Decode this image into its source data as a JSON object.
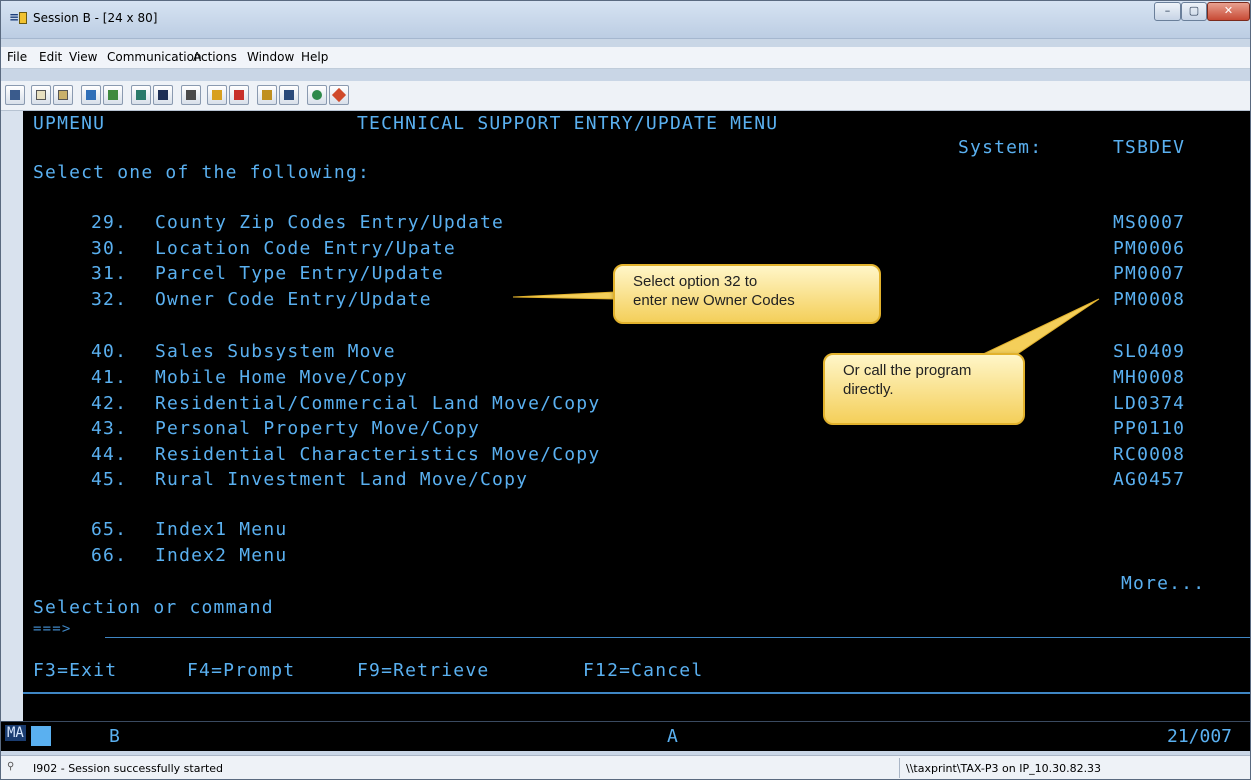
{
  "window": {
    "title": "Session B - [24 x 80]",
    "controls": {
      "minimize": "–",
      "maximize": "▢",
      "close": "✕"
    }
  },
  "menubar": {
    "items": [
      "File",
      "Edit",
      "View",
      "Communication",
      "Actions",
      "Window",
      "Help"
    ]
  },
  "toolbar": {
    "icons": [
      "display-icon",
      "copy-icon",
      "paste-icon",
      "send-icon",
      "receive-icon",
      "screen-icon",
      "macro-icon",
      "keyboard-icon",
      "record-icon",
      "stop-icon",
      "play-icon",
      "pause-icon",
      "globe-icon",
      "pencil-icon"
    ]
  },
  "screen": {
    "menu_id": "UPMENU",
    "title": "TECHNICAL SUPPORT ENTRY/UPDATE MENU",
    "system_label": "System:",
    "system_value": "TSBDEV",
    "instruction": "Select one of the following:",
    "options": [
      {
        "number": "29.",
        "label": "County Zip Codes Entry/Update",
        "program": "MS0007"
      },
      {
        "number": "30.",
        "label": "Location Code Entry/Upate",
        "program": "PM0006"
      },
      {
        "number": "31.",
        "label": "Parcel Type Entry/Update",
        "program": "PM0007"
      },
      {
        "number": "32.",
        "label": "Owner Code Entry/Update",
        "program": "PM0008"
      },
      {
        "number": "40.",
        "label": "Sales Subsystem Move",
        "program": "SL0409"
      },
      {
        "number": "41.",
        "label": "Mobile Home Move/Copy",
        "program": "MH0008"
      },
      {
        "number": "42.",
        "label": "Residential/Commercial Land Move/Copy",
        "program": "LD0374"
      },
      {
        "number": "43.",
        "label": "Personal Property Move/Copy",
        "program": "PP0110"
      },
      {
        "number": "44.",
        "label": "Residential Characteristics Move/Copy",
        "program": "RC0008"
      },
      {
        "number": "45.",
        "label": "Rural Investment Land Move/Copy",
        "program": "AG0457"
      },
      {
        "number": "65.",
        "label": "Index1 Menu",
        "program": ""
      },
      {
        "number": "66.",
        "label": "Index2 Menu",
        "program": ""
      }
    ],
    "more": "More...",
    "selection_label": "Selection or command",
    "prompt": "===>",
    "input_value": "",
    "function_keys": [
      "F3=Exit",
      "F4=Prompt",
      "F9=Retrieve",
      "F12=Cancel"
    ]
  },
  "callouts": {
    "first": [
      "Select option 32 to",
      "enter new Owner Codes"
    ],
    "second": [
      "Or call the program",
      "directly."
    ]
  },
  "oia": {
    "indicator": "MA",
    "session": "B",
    "mode": "A",
    "cursor_position": "21/007"
  },
  "status": {
    "message": "I902 - Session successfully started",
    "printer": "\\\\taxprint\\TAX-P3 on IP_10.30.82.33"
  },
  "colors": {
    "terminal_bg": "#000000",
    "terminal_text": "#5ab0f0",
    "callout_fill": "#f4cf5a",
    "callout_border": "#e2b22d"
  }
}
